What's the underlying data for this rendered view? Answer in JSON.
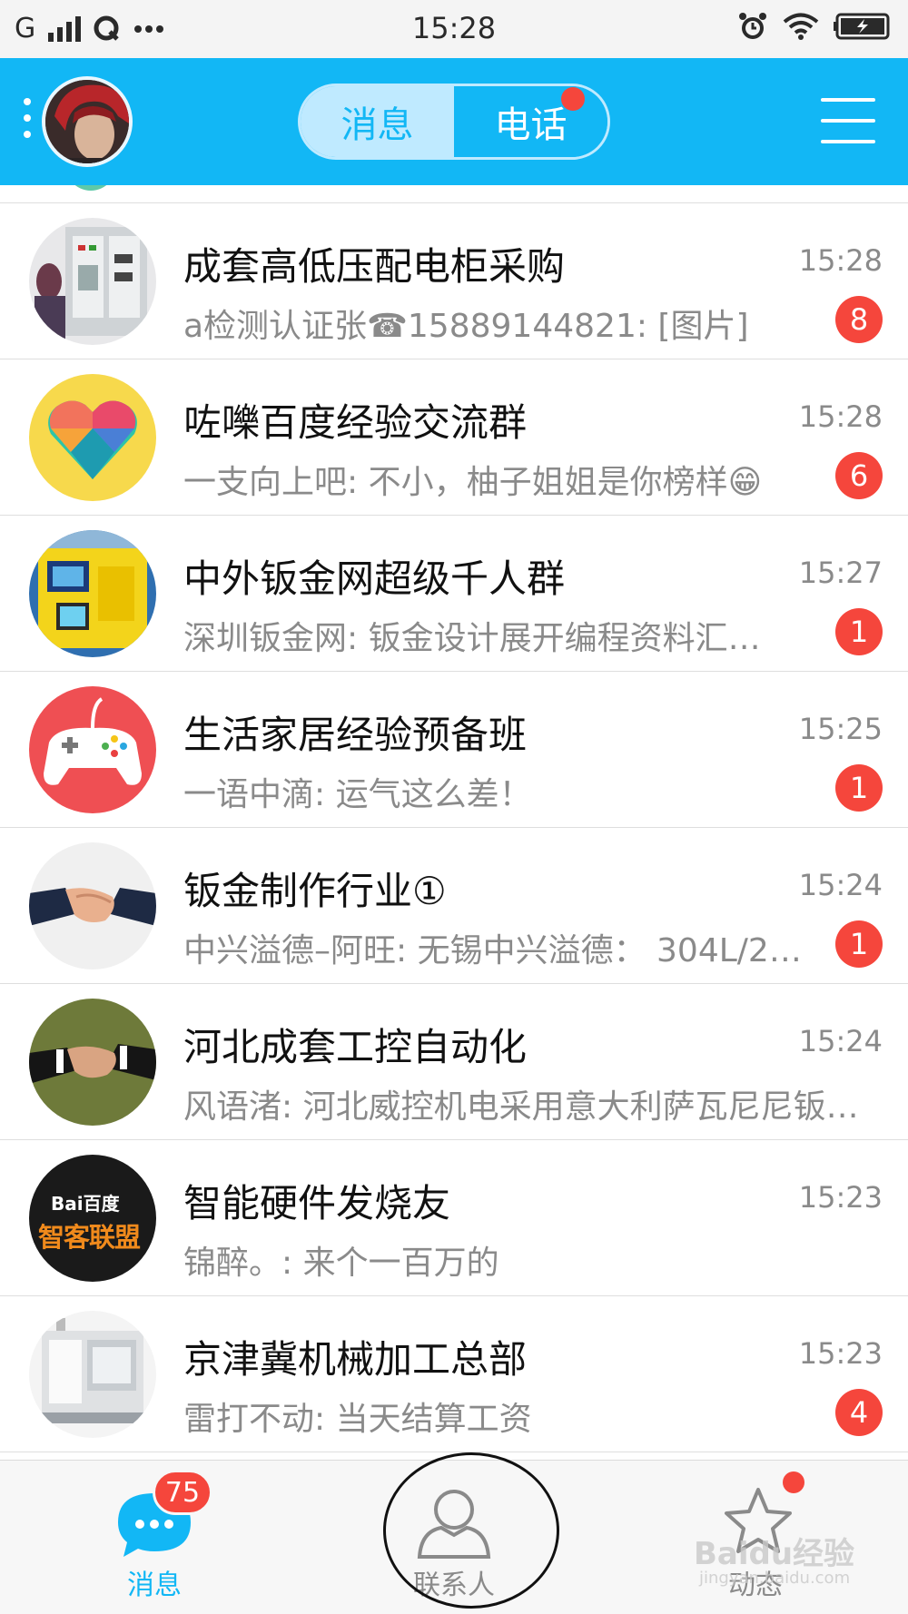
{
  "status_bar": {
    "carrier": "G",
    "time": "15:28"
  },
  "header": {
    "tabs": [
      {
        "label": "消息",
        "selected": true
      },
      {
        "label": "电话",
        "selected": false
      }
    ]
  },
  "conversations": [
    {
      "name": "成套高低压配电柜采购",
      "time": "15:28",
      "preview": "a检测认证张☎15889144821: [图片]",
      "unread": "8"
    },
    {
      "name": "咗嚛百度经验交流群",
      "time": "15:28",
      "preview": "一支向上吧: 不小，柚子姐姐是你榜样😁",
      "unread": "6"
    },
    {
      "name": "中外钣金网超级千人群",
      "time": "15:27",
      "preview": "深圳钣金网: 钣金设计展开编程资料汇…",
      "unread": "1"
    },
    {
      "name": "生活家居经验预备班",
      "time": "15:25",
      "preview": "一语中滴: 运气这么差！",
      "unread": "1"
    },
    {
      "name": "钣金制作行业①",
      "time": "15:24",
      "preview": "中兴溢德–阿旺: 无锡中兴溢德： 304L/2…",
      "unread": "1"
    },
    {
      "name": "河北成套工控自动化",
      "time": "15:24",
      "preview": "风语渚: 河北威控机电采用意大利萨瓦尼尼钣…",
      "unread": ""
    },
    {
      "name": "智能硬件发烧友",
      "time": "15:23",
      "preview": "锦醉。: 来个一百万的",
      "unread": ""
    },
    {
      "name": "京津冀机械加工总部",
      "time": "15:23",
      "preview": "雷打不动: 当天结算工资",
      "unread": "4"
    }
  ],
  "avatar_texts": {
    "baidu_logo": "Bai百度",
    "baidu_sub": "智客联盟"
  },
  "tab_bar": {
    "messages": {
      "label": "消息",
      "badge": "75"
    },
    "contacts": {
      "label": "联系人"
    },
    "dynamic": {
      "label": "动态"
    }
  },
  "watermark": {
    "main": "Baidu经验",
    "sub": "jingyan.baidu.com"
  },
  "colors": {
    "accent": "#12b7f5",
    "badge": "#f5463c"
  }
}
